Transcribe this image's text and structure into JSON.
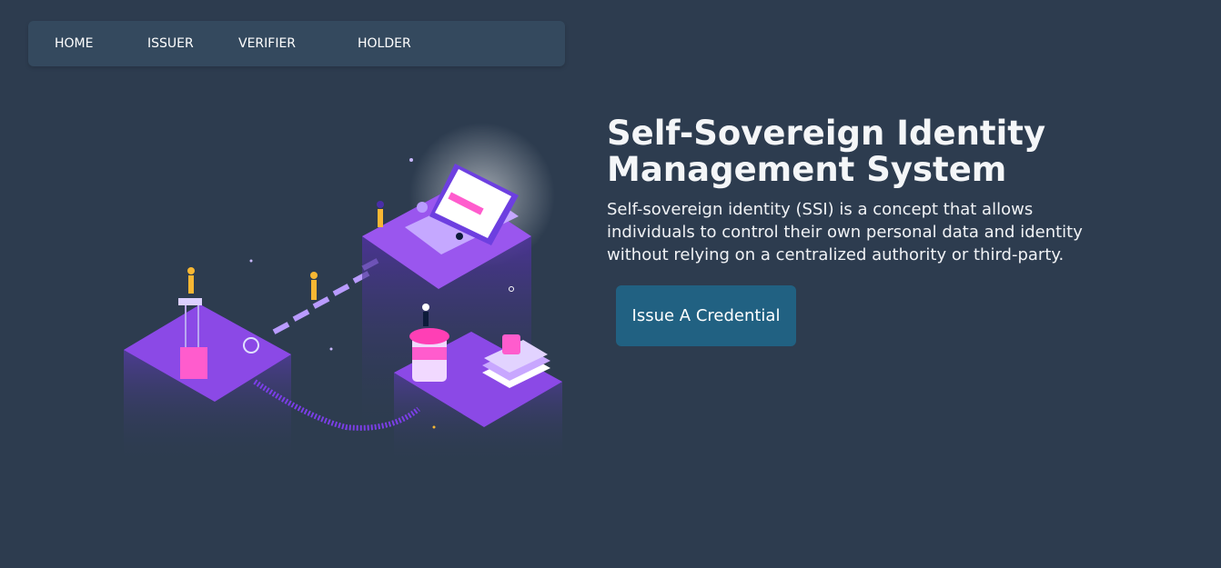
{
  "nav": {
    "items": [
      {
        "label": "HOME"
      },
      {
        "label": "ISSUER"
      },
      {
        "label": "VERIFIER"
      },
      {
        "label": "HOLDER"
      }
    ]
  },
  "hero": {
    "title": "Self-Sovereign Identity Management System",
    "description": "Self-sovereign identity (SSI) is a concept that allows individuals to control their own personal data and identity without relying on a centralized authority or third-party.",
    "cta_label": "Issue A Credential"
  },
  "colors": {
    "background": "#2d3c4f",
    "navbar": "#34495e",
    "cta": "#216182",
    "illustration_primary": "#7b3fe4",
    "illustration_accent": "#ff4fc8"
  },
  "illustration": {
    "icon": "isometric-identity-network-illustration"
  }
}
